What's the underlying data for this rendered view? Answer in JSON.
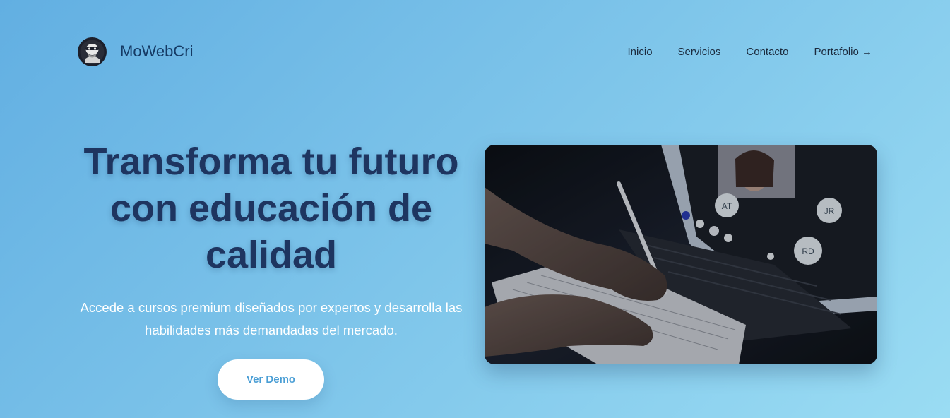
{
  "brand": {
    "name": "MoWebCri",
    "logo_icon": "masked-face-icon"
  },
  "nav": {
    "items": [
      {
        "label": "Inicio"
      },
      {
        "label": "Servicios"
      },
      {
        "label": "Contacto"
      },
      {
        "label": "Portafolio →"
      }
    ]
  },
  "hero": {
    "title": "Transforma tu futuro con educación de calidad",
    "subtitle": "Accede a cursos premium diseñados por expertos y desarrolla las habilidades más demandadas del mercado.",
    "cta_label": "Ver Demo",
    "image": {
      "participant_initials": [
        "AT",
        "JR",
        "RD"
      ]
    }
  },
  "colors": {
    "background_start": "#62afe2",
    "background_end": "#9adcf3",
    "title": "#1e3560",
    "brand_text": "#153a64",
    "cta_text": "#4a9ed5"
  }
}
